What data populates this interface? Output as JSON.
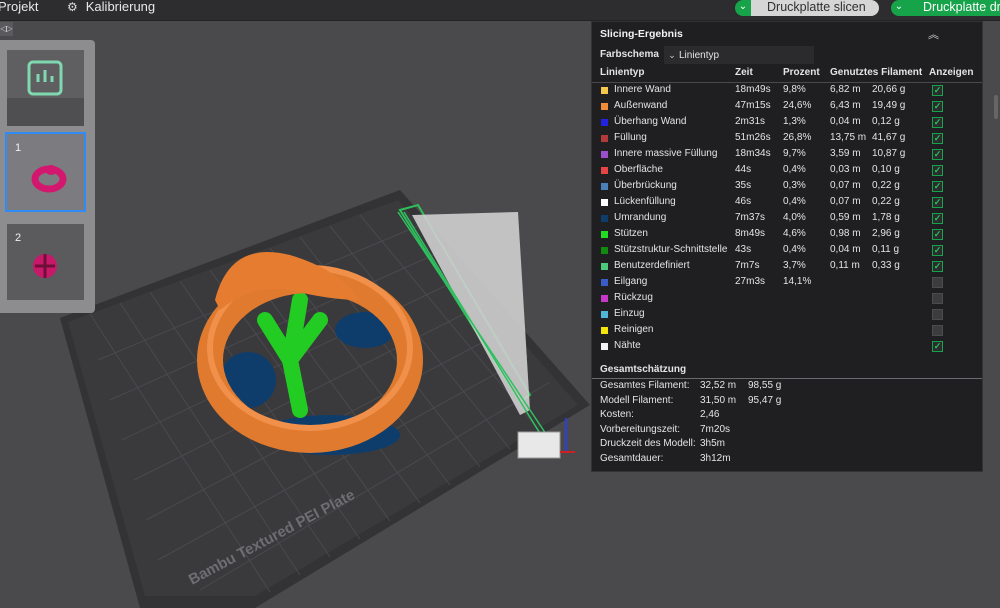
{
  "topbar": {
    "menu": [
      {
        "label": "Projekt"
      },
      {
        "label": "Kalibrierung",
        "icon": "gear-icon"
      }
    ],
    "slice_button_label": "Druckplatte slicen",
    "print_button_label": "Druckplatte drucken",
    "accent_color": "#16a34a"
  },
  "plate_panel": {
    "plates": [
      {
        "number": "",
        "selected": false
      },
      {
        "number": "1",
        "selected": true
      },
      {
        "number": "2",
        "selected": false
      }
    ]
  },
  "scene": {
    "bed_label": "Bambu Textured PEI Plate"
  },
  "result_panel": {
    "title": "Slicing-Ergebnis",
    "scheme_label": "Farbschema",
    "scheme_value": "Linientyp",
    "columns": [
      "Linientyp",
      "Zeit",
      "Prozent",
      "Genutztes Filament",
      "Anzeigen"
    ],
    "rows": [
      {
        "name": "Innere Wand",
        "color": "#f2c94c",
        "time": "18m49s",
        "percent": "9,8%",
        "length": "6,82 m",
        "weight": "20,66 g",
        "shown": true
      },
      {
        "name": "Außenwand",
        "color": "#f28c38",
        "time": "47m15s",
        "percent": "24,6%",
        "length": "6,43 m",
        "weight": "19,49 g",
        "shown": true
      },
      {
        "name": "Überhang Wand",
        "color": "#2222e0",
        "time": "2m31s",
        "percent": "1,3%",
        "length": "0,04 m",
        "weight": "0,12 g",
        "shown": true
      },
      {
        "name": "Füllung",
        "color": "#b23a3a",
        "time": "51m26s",
        "percent": "26,8%",
        "length": "13,75 m",
        "weight": "41,67 g",
        "shown": true
      },
      {
        "name": "Innere massive Füllung",
        "color": "#9b4fc8",
        "time": "18m34s",
        "percent": "9,7%",
        "length": "3,59 m",
        "weight": "10,87 g",
        "shown": true
      },
      {
        "name": "Oberfläche",
        "color": "#e64545",
        "time": "44s",
        "percent": "0,4%",
        "length": "0,03 m",
        "weight": "0,10 g",
        "shown": true
      },
      {
        "name": "Überbrückung",
        "color": "#4a7fb8",
        "time": "35s",
        "percent": "0,3%",
        "length": "0,07 m",
        "weight": "0,22 g",
        "shown": true
      },
      {
        "name": "Lückenfüllung",
        "color": "#ffffff",
        "time": "46s",
        "percent": "0,4%",
        "length": "0,07 m",
        "weight": "0,22 g",
        "shown": true
      },
      {
        "name": "Umrandung",
        "color": "#0f3d6b",
        "time": "7m37s",
        "percent": "4,0%",
        "length": "0,59 m",
        "weight": "1,78 g",
        "shown": true
      },
      {
        "name": "Stützen",
        "color": "#22dd22",
        "time": "8m49s",
        "percent": "4,6%",
        "length": "0,98 m",
        "weight": "2,96 g",
        "shown": true
      },
      {
        "name": "Stützstruktur-Schnittstelle",
        "color": "#128a12",
        "time": "43s",
        "percent": "0,4%",
        "length": "0,04 m",
        "weight": "0,11 g",
        "shown": true
      },
      {
        "name": "Benutzerdefiniert",
        "color": "#4cc97a",
        "time": "7m7s",
        "percent": "3,7%",
        "length": "0,11 m",
        "weight": "0,33 g",
        "shown": true
      },
      {
        "name": "Eilgang",
        "color": "#3b5cc6",
        "time": "27m3s",
        "percent": "14,1%",
        "length": "",
        "weight": "",
        "shown": false
      },
      {
        "name": "Rückzug",
        "color": "#c838c8",
        "time": "",
        "percent": "",
        "length": "",
        "weight": "",
        "shown": false
      },
      {
        "name": "Einzug",
        "color": "#4fb4d8",
        "time": "",
        "percent": "",
        "length": "",
        "weight": "",
        "shown": false
      },
      {
        "name": "Reinigen",
        "color": "#f5e50a",
        "time": "",
        "percent": "",
        "length": "",
        "weight": "",
        "shown": false
      },
      {
        "name": "Nähte",
        "color": "#f2f2f2",
        "time": "",
        "percent": "",
        "length": "",
        "weight": "",
        "shown": true
      }
    ],
    "summary_title": "Gesamtschätzung",
    "summary": [
      {
        "label": "Gesamtes Filament:",
        "value1": "32,52 m",
        "value2": "98,55 g"
      },
      {
        "label": "Modell Filament:",
        "value1": "31,50 m",
        "value2": "95,47 g"
      },
      {
        "label": "Kosten:",
        "value1": "2,46",
        "value2": ""
      },
      {
        "label": "Vorbereitungszeit:",
        "value1": "7m20s",
        "value2": ""
      },
      {
        "label": "Druckzeit des Modell:",
        "value1": "3h5m",
        "value2": ""
      },
      {
        "label": "Gesamtdauer:",
        "value1": "3h12m",
        "value2": ""
      }
    ]
  }
}
